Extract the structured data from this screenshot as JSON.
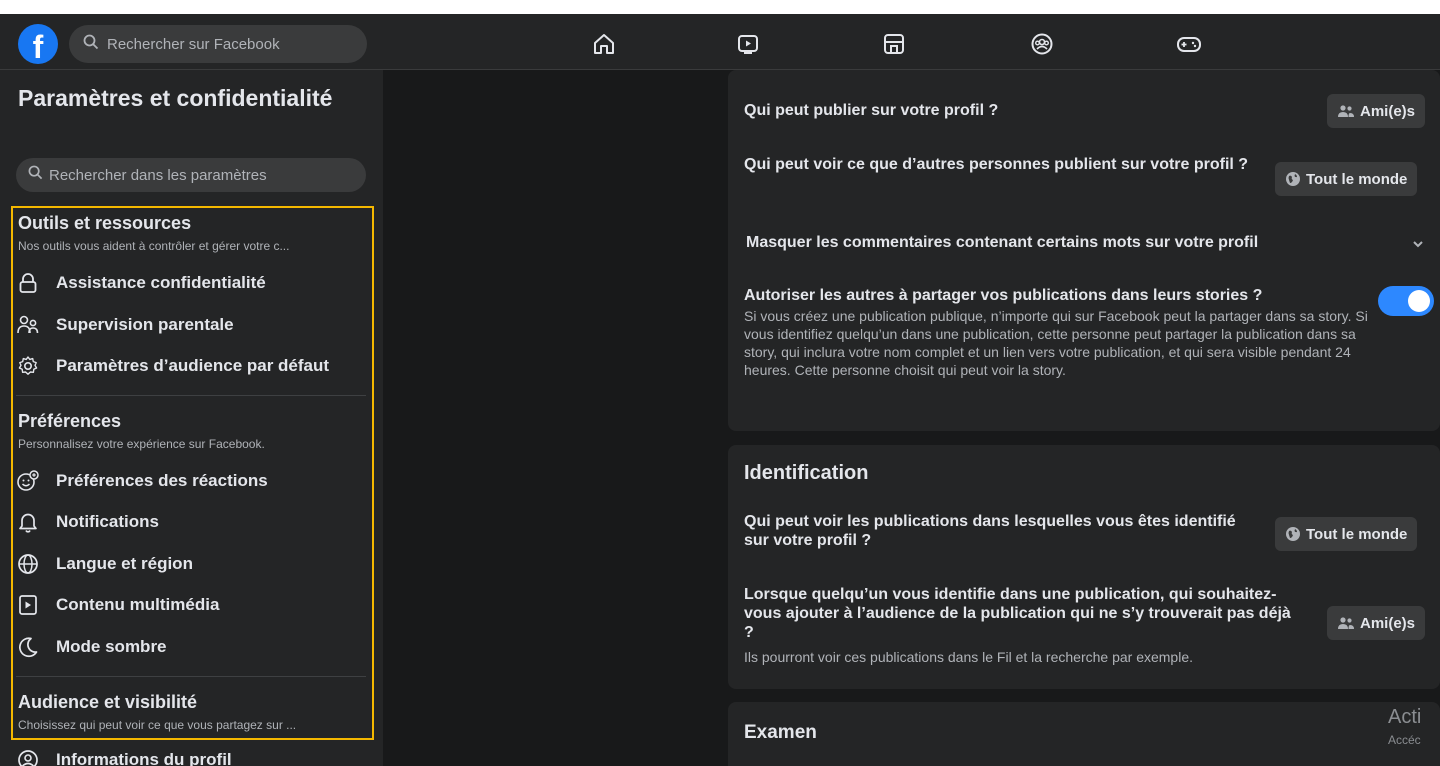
{
  "header": {
    "search_placeholder": "Rechercher sur Facebook",
    "logo_letter": "f",
    "nav_icons": [
      "home-icon",
      "video-icon",
      "marketplace-icon",
      "groups-icon",
      "gaming-icon"
    ]
  },
  "sidebar": {
    "title": "Paramètres et confidentialité",
    "search_placeholder": "Rechercher dans les paramètres",
    "sections": [
      {
        "title": "Outils et ressources",
        "subtitle": "Nos outils vous aident à contrôler et gérer votre c...",
        "items": [
          {
            "label": "Assistance confidentialité",
            "icon": "lock-icon"
          },
          {
            "label": "Supervision parentale",
            "icon": "family-icon"
          },
          {
            "label": "Paramètres d’audience par défaut",
            "icon": "gear-icon"
          }
        ]
      },
      {
        "title": "Préférences",
        "subtitle": "Personnalisez votre expérience sur Facebook.",
        "items": [
          {
            "label": "Préférences des réactions",
            "icon": "reaction-icon"
          },
          {
            "label": "Notifications",
            "icon": "bell-icon"
          },
          {
            "label": "Langue et région",
            "icon": "globe-icon"
          },
          {
            "label": "Contenu multimédia",
            "icon": "media-icon"
          },
          {
            "label": "Mode sombre",
            "icon": "moon-icon"
          }
        ]
      },
      {
        "title": "Audience et visibilité",
        "subtitle": "Choisissez qui peut voir ce que vous partagez sur ...",
        "items": [
          {
            "label": "Informations du profil",
            "icon": "profile-icon"
          }
        ]
      }
    ]
  },
  "main": {
    "profile_panel": {
      "q1": "Qui peut publier sur votre profil ?",
      "q1_value": "Ami(e)s",
      "q2": "Qui peut voir ce que d’autres personnes publient sur votre profil ?",
      "q2_value": "Tout le monde",
      "q3": "Masquer les commentaires contenant certains mots sur votre profil",
      "q4": "Autoriser les autres à partager vos publications dans leurs stories ?",
      "q4_desc": "Si vous créez une publication publique, n’importe qui sur Facebook peut la partager dans sa story. Si vous identifiez quelqu’un dans une publication, cette personne peut partager la publication dans sa story, qui inclura votre nom complet et un lien vers votre publication, et qui sera visible pendant 24 heures. Cette personne choisit qui peut voir la story.",
      "q4_toggle_on": true
    },
    "identification_panel": {
      "title": "Identification",
      "q1": "Qui peut voir les publications dans lesquelles vous êtes identifié sur votre profil ?",
      "q1_value": "Tout le monde",
      "q2": "Lorsque quelqu’un vous identifie dans une publication, qui souhaitez-vous ajouter à l’audience de la publication qui ne s’y trouverait pas déjà ?",
      "q2_value": "Ami(e)s",
      "q2_desc": "Ils pourront voir ces publications dans le Fil et la recherche par exemple."
    },
    "examen_panel": {
      "title": "Examen"
    },
    "watermark": {
      "line1": "Acti",
      "line2": "Accéc"
    }
  },
  "colors": {
    "brand": "#1877f2",
    "toggle": "#2d88ff",
    "highlight": "#f5b800",
    "panel": "#242526",
    "background": "#18191a"
  }
}
